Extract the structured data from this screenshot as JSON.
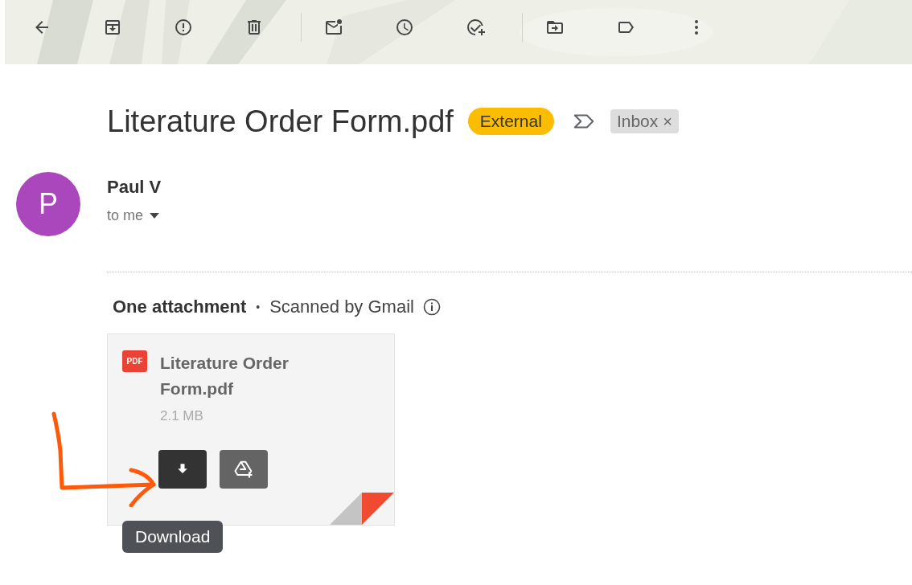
{
  "toolbar": {
    "actions": [
      {
        "kind": "back"
      },
      {
        "kind": "archive"
      },
      {
        "kind": "spam"
      },
      {
        "kind": "delete"
      },
      {
        "kind": "sep"
      },
      {
        "kind": "unread"
      },
      {
        "kind": "snooze"
      },
      {
        "kind": "task"
      },
      {
        "kind": "sep"
      },
      {
        "kind": "move"
      },
      {
        "kind": "label"
      },
      {
        "kind": "more"
      }
    ]
  },
  "subject": "Literature Order Form.pdf",
  "badges": [
    {
      "kind": "external",
      "label": "External"
    },
    {
      "kind": "important"
    },
    {
      "kind": "inbox",
      "label": "Inbox",
      "close": "×"
    }
  ],
  "sender": {
    "initial": "P",
    "name": "Paul V",
    "recipient": "to me"
  },
  "attachments_header": {
    "count": "One attachment",
    "separator": "•",
    "scan": "Scanned by Gmail"
  },
  "attachment": {
    "type_label": "PDF",
    "name": "Literature Order Form.pdf",
    "size": "2.1 MB",
    "tooltip": "Download"
  }
}
